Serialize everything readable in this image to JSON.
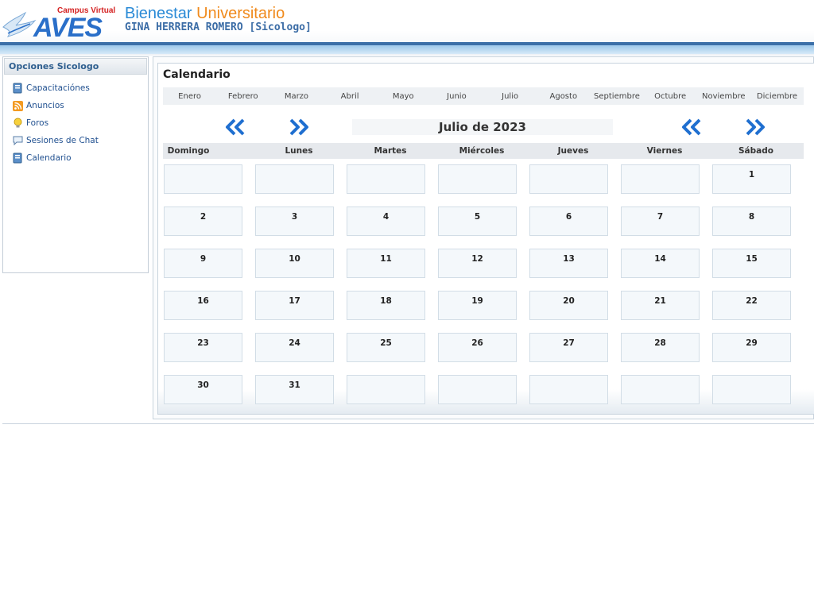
{
  "brand": {
    "campus": "Campus Virtual",
    "logo": "AVES",
    "title_part1": "Bienestar",
    "title_part2": "Universitario",
    "user_line": "GINA HERRERA ROMERO [Sicologo]",
    "colors": {
      "accent_blue": "#2a8ad6",
      "accent_orange": "#f08a1c",
      "band": "#3b6fa8"
    }
  },
  "sidebar": {
    "title": "Opciones Sicologo",
    "items": [
      {
        "label": "Capacitaciónes",
        "icon": "book-icon"
      },
      {
        "label": "Anuncios",
        "icon": "rss-icon"
      },
      {
        "label": "Foros",
        "icon": "lightbulb-icon"
      },
      {
        "label": "Sesiones de Chat",
        "icon": "chat-bubble-icon"
      },
      {
        "label": "Calendario",
        "icon": "book-icon"
      }
    ]
  },
  "calendar": {
    "title": "Calendario",
    "months": [
      "Enero",
      "Febrero",
      "Marzo",
      "Abril",
      "Mayo",
      "Junio",
      "Julio",
      "Agosto",
      "Septiembre",
      "Octubre",
      "Noviembre",
      "Diciembre"
    ],
    "current": "Julio de 2023",
    "weekdays": [
      "Domingo",
      "Lunes",
      "Martes",
      "Miércoles",
      "Jueves",
      "Viernes",
      "Sábado"
    ],
    "first_weekday_index": 6,
    "days_in_month": 31,
    "rows": 6
  }
}
